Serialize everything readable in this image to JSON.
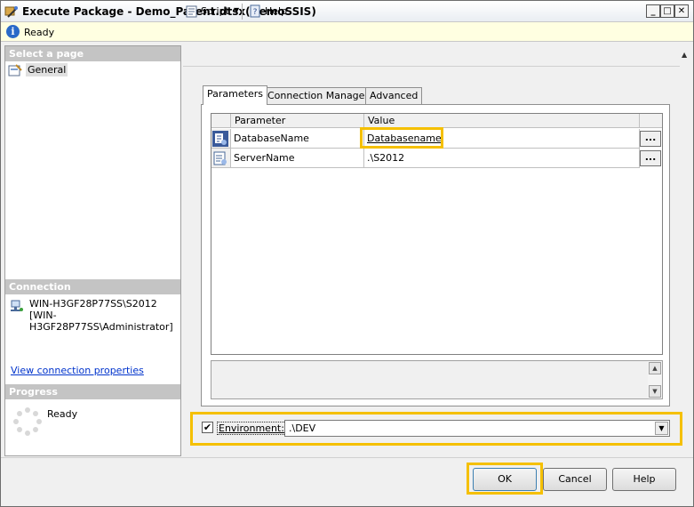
{
  "window": {
    "title": "Execute Package - Demo_Parent.dtsx(DemoSSIS)",
    "controls": {
      "minimize": "_",
      "maximize": "□",
      "close": "✕"
    }
  },
  "status": {
    "text": "Ready",
    "icon": "info-icon"
  },
  "left": {
    "select_page_header": "Select a page",
    "pages": [
      {
        "label": "General",
        "icon": "page-icon"
      }
    ],
    "connection_header": "Connection",
    "connection_text": "WIN-H3GF28P77SS\\S2012 [WIN-H3GF28P77SS\\Administrator]",
    "view_connection_link": "View connection properties",
    "progress_header": "Progress",
    "progress_status": "Ready"
  },
  "toolbar": {
    "script_label": "Script",
    "help_label": "Help"
  },
  "tabs": [
    {
      "label": "Parameters",
      "active": true
    },
    {
      "label": "Connection Managers",
      "active": false
    },
    {
      "label": "Advanced",
      "active": false
    }
  ],
  "grid": {
    "columns": [
      "Parameter",
      "Value"
    ],
    "rows": [
      {
        "parameter": "DatabaseName",
        "value": "Databasename",
        "ellipsis": "..."
      },
      {
        "parameter": "ServerName",
        "value": ".\\S2012",
        "ellipsis": "..."
      }
    ]
  },
  "environment": {
    "label": "Environment:",
    "checked": true,
    "check_mark": "✔",
    "selected": ".\\DEV"
  },
  "buttons": {
    "ok": "OK",
    "cancel": "Cancel",
    "help": "Help"
  },
  "colors": {
    "highlight": "#f5c000",
    "status_bg": "#ffffe1",
    "section_header": "#c4c4c4",
    "link": "#0033cc"
  }
}
